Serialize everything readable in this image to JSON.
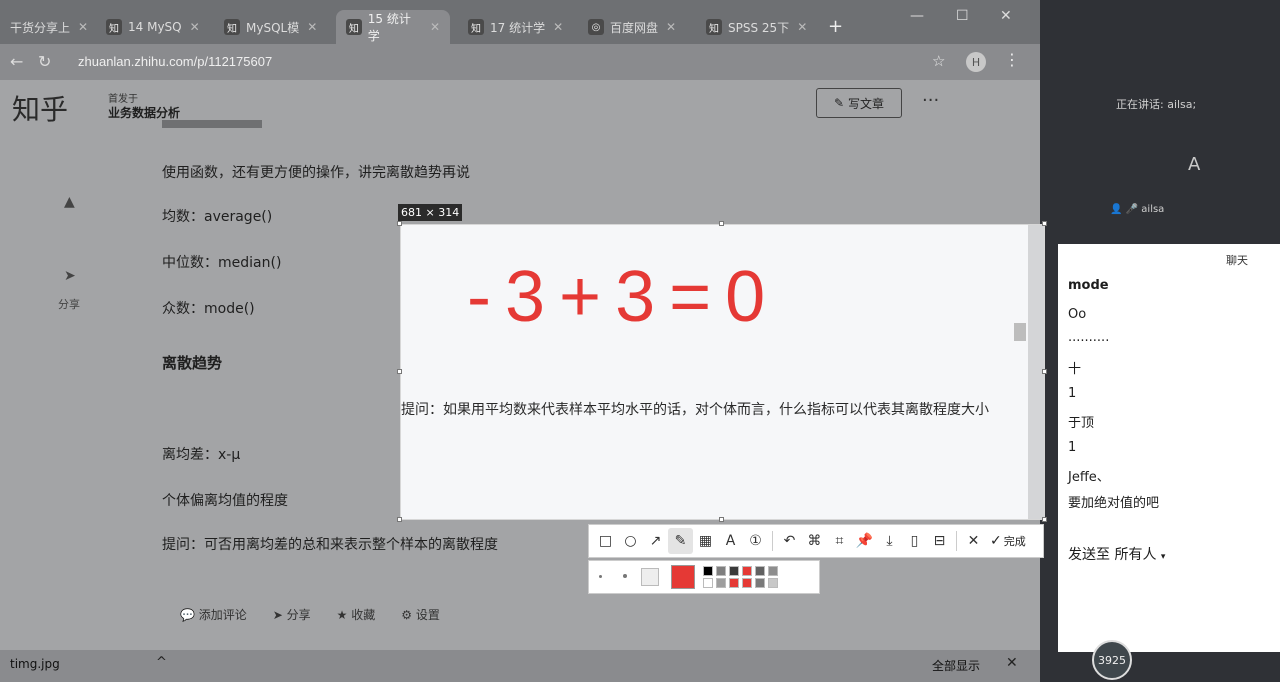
{
  "browser": {
    "tabs": [
      {
        "icon": "",
        "label": "干货分享上",
        "active": false
      },
      {
        "icon": "知",
        "label": "14 MySQ",
        "active": false
      },
      {
        "icon": "知",
        "label": "MySQL模",
        "active": false
      },
      {
        "icon": "知",
        "label": "15 统计学",
        "active": true
      },
      {
        "icon": "知",
        "label": "17 统计学",
        "active": false
      },
      {
        "icon": "◎",
        "label": "百度网盘",
        "active": false
      },
      {
        "icon": "知",
        "label": "SPSS 25下",
        "active": false
      }
    ],
    "url": "zhuanlan.zhihu.com/p/112175607",
    "profile_initial": "H"
  },
  "page": {
    "logo": "知乎",
    "column_small": "首发于",
    "column_title": "业务数据分析",
    "write_button": "写文章",
    "side_share": "分享",
    "paragraphs": [
      "使用函数，还有更方便的操作，讲完离散趋势再说",
      "均数：average()",
      "中位数：median()",
      "众数：mode()",
      "离散趋势",
      "提问：如果用平均数来代表样本平均水平的话，对个体而言，什么指标可以代表其离散程度大小",
      "离均差：x-μ",
      "个体偏离均值的程度",
      "提问：可否用离均差的总和来表示整个样本的离散程度"
    ],
    "actions": [
      "添加评论",
      "分享",
      "收藏",
      "设置"
    ]
  },
  "downloads": {
    "file": "timg.jpg",
    "show_all": "全部显示"
  },
  "capture": {
    "size_label": "681 × 314",
    "handwriting": "-3+3=0"
  },
  "toolbar": {
    "done_label": "完成"
  },
  "meeting": {
    "speaking": "正在讲话: ailsa;",
    "speaker_avatar": "A",
    "speaker_name": "ailsa",
    "chat_title": "聊天",
    "messages": [
      "mode",
      "Oo",
      "..........",
      "十",
      "1",
      "于顶",
      "1",
      "Jeffe、",
      "要加绝对值的吧"
    ],
    "send_to": "发送至 所有人",
    "user_badge": "3925"
  },
  "colors": {
    "pen": "#e53935",
    "palette": [
      "#000000",
      "#7f7f7f",
      "#3a3a3a",
      "#e53935",
      "#616161",
      "#8e8e8e",
      "#ffffff",
      "#9e9e9e",
      "#e53935",
      "#e53935",
      "#7a7a7a",
      "#c8c8c8"
    ]
  }
}
